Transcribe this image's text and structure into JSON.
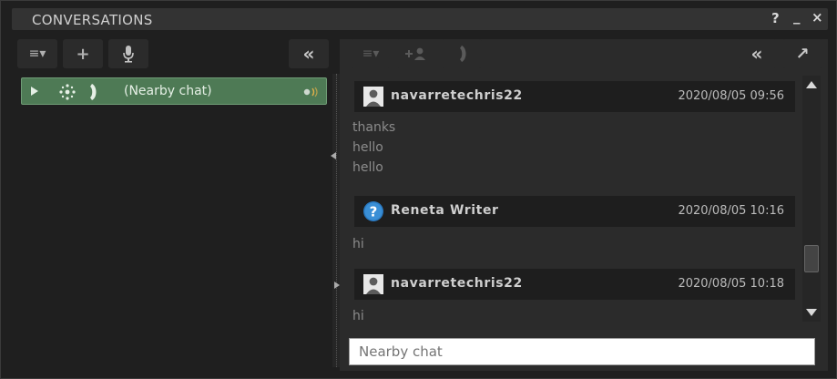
{
  "window": {
    "title": "CONVERSATIONS",
    "help": "?",
    "minimize": "_",
    "close": "×"
  },
  "left_toolbar": {
    "options_icon": "≡▾",
    "add_icon": "+",
    "voice_icon": "microphone",
    "collapse_icon": "«"
  },
  "conversations": [
    {
      "label": "(Nearby chat)",
      "icons": [
        "expand-arrow",
        "nearby-people",
        "call-handset"
      ],
      "status": "voice-indicator"
    }
  ],
  "right_toolbar": {
    "options_icon": "≡▾",
    "add_person_icon": "+person",
    "call_icon": "call-handset",
    "collapse_icon": "«",
    "tear_off_icon": "↗"
  },
  "messages": [
    {
      "sender": "navarretechris22",
      "time": "2020/08/05 09:56",
      "avatar": "person-avatar",
      "lines": [
        "thanks",
        "hello",
        "hello"
      ]
    },
    {
      "sender": "Reneta Writer",
      "time": "2020/08/05 10:16",
      "avatar": "question-avatar",
      "lines": [
        "hi"
      ]
    },
    {
      "sender": "navarretechris22",
      "time": "2020/08/05 10:18",
      "avatar": "person-avatar",
      "lines": [
        "hi"
      ]
    }
  ],
  "input": {
    "placeholder": "Nearby chat",
    "value": ""
  },
  "colors": {
    "selected_item": "#4e7a55",
    "panel": "#2b2b2b",
    "background": "#1f1f1f"
  }
}
